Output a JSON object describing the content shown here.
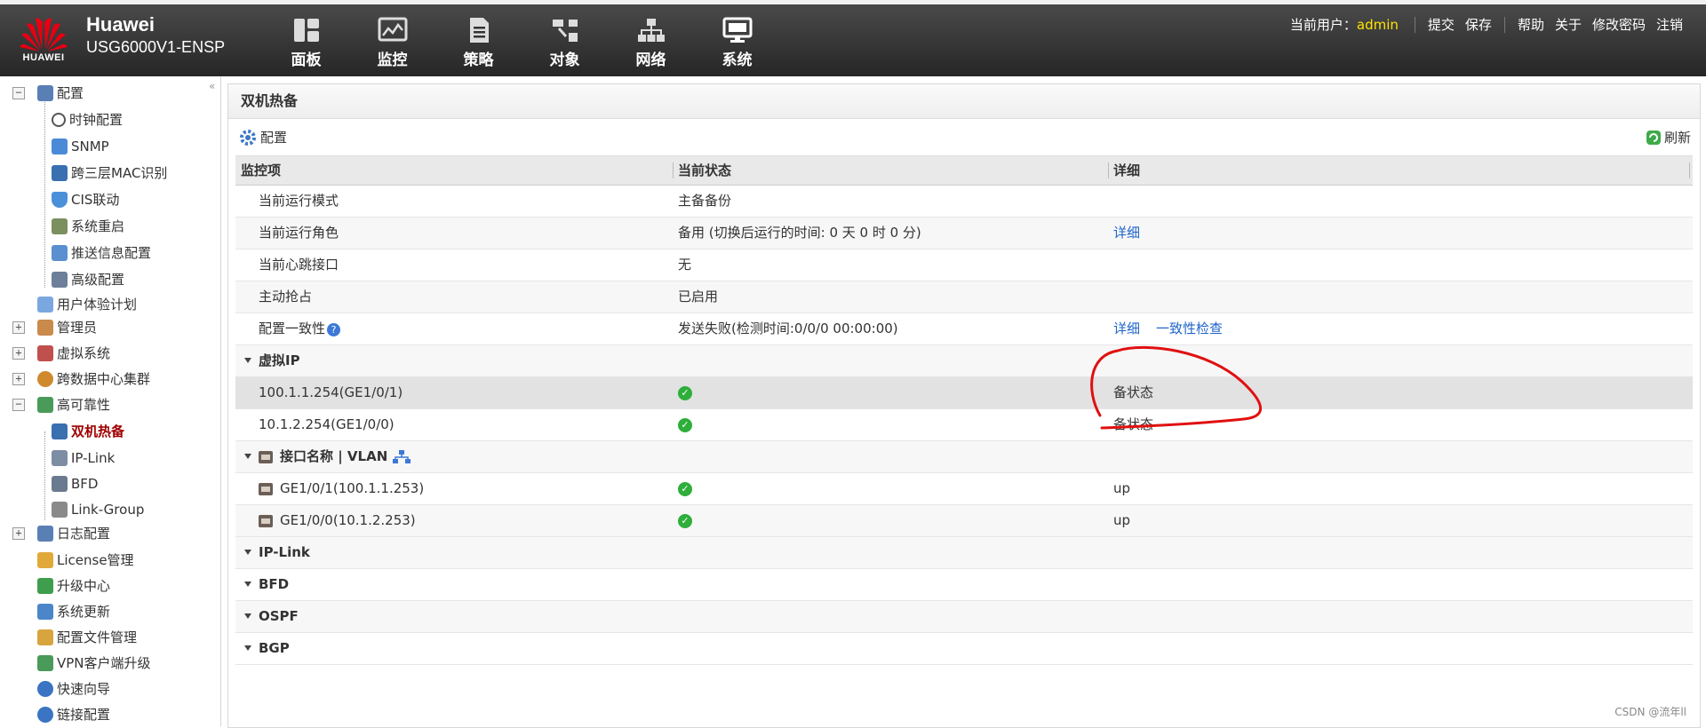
{
  "header": {
    "brand_line1": "Huawei",
    "brand_line2": "USG6000V1-ENSP",
    "logo_text": "HUAWEI",
    "nav": [
      {
        "label": "面板",
        "icon": "dashboard-icon"
      },
      {
        "label": "监控",
        "icon": "monitor-chart-icon"
      },
      {
        "label": "策略",
        "icon": "policy-document-icon"
      },
      {
        "label": "对象",
        "icon": "objects-icon"
      },
      {
        "label": "网络",
        "icon": "network-topology-icon"
      },
      {
        "label": "系统",
        "icon": "system-monitor-icon"
      }
    ],
    "user_label": "当前用户：",
    "user_name": "admin",
    "links": {
      "submit": "提交",
      "save": "保存",
      "help": "帮助",
      "about": "关于",
      "change_password": "修改密码",
      "logout": "注销"
    }
  },
  "sidebar": {
    "items": [
      {
        "label": "配置"
      },
      {
        "label": "时钟配置"
      },
      {
        "label": "SNMP"
      },
      {
        "label": "跨三层MAC识别"
      },
      {
        "label": "CIS联动"
      },
      {
        "label": "系统重启"
      },
      {
        "label": "推送信息配置"
      },
      {
        "label": "高级配置"
      },
      {
        "label": "用户体验计划"
      },
      {
        "label": "管理员"
      },
      {
        "label": "虚拟系统"
      },
      {
        "label": "跨数据中心集群"
      },
      {
        "label": "高可靠性"
      },
      {
        "label": "双机热备"
      },
      {
        "label": "IP-Link"
      },
      {
        "label": "BFD"
      },
      {
        "label": "Link-Group"
      },
      {
        "label": "日志配置"
      },
      {
        "label": "License管理"
      },
      {
        "label": "升级中心"
      },
      {
        "label": "系统更新"
      },
      {
        "label": "配置文件管理"
      },
      {
        "label": "VPN客户端升级"
      },
      {
        "label": "快速向导"
      },
      {
        "label": "链接配置"
      }
    ]
  },
  "panel": {
    "title": "双机热备",
    "config_label": "配置",
    "refresh_label": "刷新",
    "columns": [
      "监控项",
      "当前状态",
      "详细"
    ],
    "rows": {
      "mode": {
        "item": "当前运行模式",
        "status": "主备备份"
      },
      "role": {
        "item": "当前运行角色",
        "status": "备用 (切换后运行的时间: 0 天 0 时 0 分)",
        "detail": "详细"
      },
      "heartbeat": {
        "item": "当前心跳接口",
        "status": "无"
      },
      "preempt": {
        "item": "主动抢占",
        "status": "已启用"
      },
      "consistency": {
        "item": "配置一致性",
        "status": "发送失败(检测时间:0/0/0 00:00:00)",
        "detail": "详细",
        "check": "一致性检查"
      }
    },
    "groups": {
      "vip": "虚拟IP",
      "iface": "接口名称 | VLAN",
      "iplink": "IP-Link",
      "bfd": "BFD",
      "ospf": "OSPF",
      "bgp": "BGP"
    },
    "vip_rows": [
      {
        "item": "100.1.1.254(GE1/0/1)",
        "detail": "备状态"
      },
      {
        "item": "10.1.2.254(GE1/0/0)",
        "detail": "备状态"
      }
    ],
    "iface_rows": [
      {
        "item": "GE1/0/1(100.1.1.253)",
        "detail": "up"
      },
      {
        "item": "GE1/0/0(10.1.2.253)",
        "detail": "up"
      }
    ]
  },
  "watermark": "CSDN @流年ll"
}
